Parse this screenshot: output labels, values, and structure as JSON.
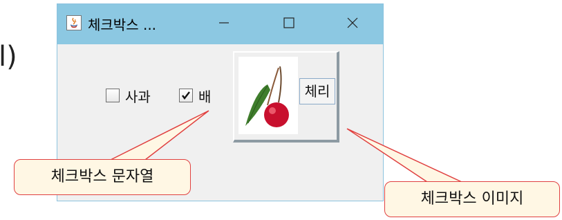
{
  "background_text": {
    "paren": "l)"
  },
  "window": {
    "title": "체크박스 ...",
    "controls": {
      "minimize_icon": "minimize-icon",
      "maximize_icon": "maximize-icon",
      "close_icon": "close-icon"
    }
  },
  "checkboxes": [
    {
      "label": "사과",
      "checked": false
    },
    {
      "label": "배",
      "checked": true
    }
  ],
  "image_checkbox": {
    "label": "체리",
    "image": "cherry-icon"
  },
  "callouts": {
    "string_label": "체크박스 문자열",
    "image_label": "체크박스 이미지"
  },
  "colors": {
    "titlebar": "#8cc8e2",
    "window_bg": "#f0f0f0",
    "callout_fill": "#fff7e4",
    "callout_border": "#e04040"
  }
}
